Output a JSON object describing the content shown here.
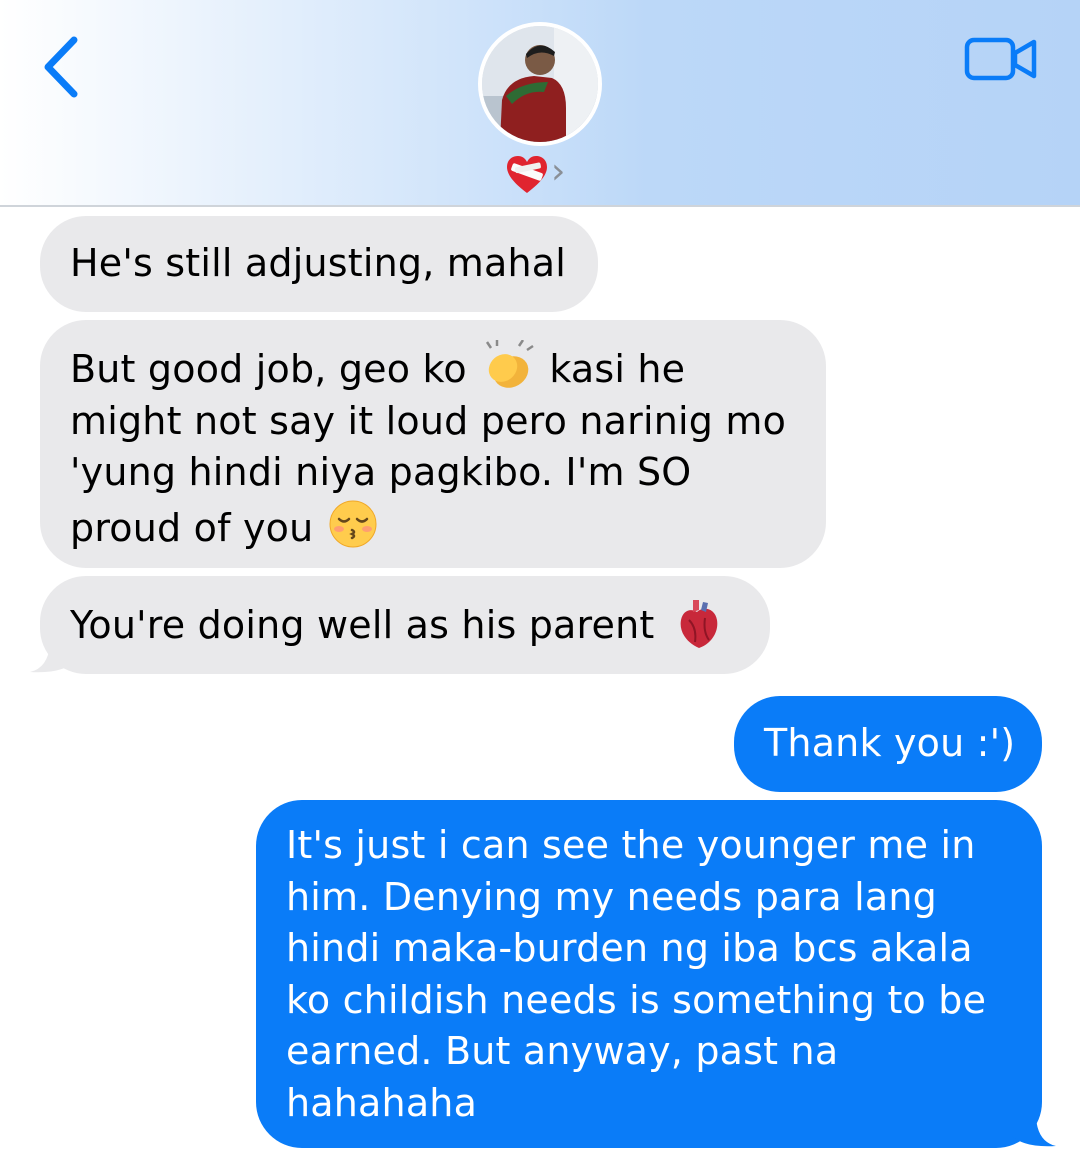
{
  "conversation": {
    "status_emoji": "heart-with-bandage",
    "status_chevron": "›"
  },
  "messages": [
    {
      "direction": "incoming",
      "text": "He's still adjusting, mahal"
    },
    {
      "direction": "incoming",
      "line1_a": "But good job, geo ko",
      "emoji1": "clapping-hands",
      "line1_b": "kasi he",
      "line2": "might not say it loud pero narinig mo",
      "line3": "'yung hindi niya pagkibo. I'm SO",
      "line4": "proud of you",
      "emoji2": "kissing-face-closed-eyes"
    },
    {
      "direction": "incoming",
      "text": "You're doing well as his parent",
      "emoji": "anatomical-heart"
    },
    {
      "direction": "outgoing",
      "text": "Thank you :')"
    },
    {
      "direction": "outgoing",
      "lines": [
        "It's just i can see the younger me in",
        "him. Denying my needs para lang",
        "hindi maka-burden ng iba bcs akala",
        "ko childish needs is something to be",
        "earned. But anyway, past na",
        "hahahaha"
      ]
    }
  ],
  "colors": {
    "incoming_bubble": "#e9e9eb",
    "outgoing_bubble": "#0a7cf8",
    "accent": "#0a7cf8"
  }
}
